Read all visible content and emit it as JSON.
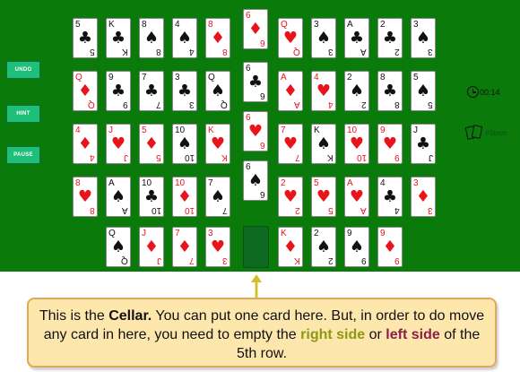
{
  "buttons": {
    "undo": "UNDO",
    "hint": "HINT",
    "pause": "PAUSE"
  },
  "status": {
    "timer": "00:14",
    "steps": "#Steps"
  },
  "cards": [
    {
      "r": "5",
      "s": "♣"
    },
    {
      "r": "K",
      "s": "♣"
    },
    {
      "r": "8",
      "s": "♠"
    },
    {
      "r": "4",
      "s": "♠"
    },
    {
      "r": "8",
      "s": "♦"
    },
    {
      "r": "6",
      "s": "♦"
    },
    {
      "r": "Q",
      "s": "♥"
    },
    {
      "r": "3",
      "s": "♠"
    },
    {
      "r": "A",
      "s": "♣"
    },
    {
      "r": "2",
      "s": "♣"
    },
    {
      "r": "3",
      "s": "♠"
    },
    {
      "r": "Q",
      "s": "♦"
    },
    {
      "r": "9",
      "s": "♣"
    },
    {
      "r": "7",
      "s": "♣"
    },
    {
      "r": "3",
      "s": "♣"
    },
    {
      "r": "Q",
      "s": "♠"
    },
    {
      "r": "6",
      "s": "♣"
    },
    {
      "r": "A",
      "s": "♦"
    },
    {
      "r": "4",
      "s": "♥"
    },
    {
      "r": "2",
      "s": "♠"
    },
    {
      "r": "8",
      "s": "♣"
    },
    {
      "r": "5",
      "s": "♠"
    },
    {
      "r": "4",
      "s": "♦"
    },
    {
      "r": "J",
      "s": "♥"
    },
    {
      "r": "5",
      "s": "♦"
    },
    {
      "r": "10",
      "s": "♠"
    },
    {
      "r": "K",
      "s": "♥"
    },
    {
      "r": "6",
      "s": "♥"
    },
    {
      "r": "7",
      "s": "♥"
    },
    {
      "r": "K",
      "s": "♠"
    },
    {
      "r": "10",
      "s": "♥"
    },
    {
      "r": "9",
      "s": "♥"
    },
    {
      "r": "J",
      "s": "♣"
    },
    {
      "r": "8",
      "s": "♥"
    },
    {
      "r": "A",
      "s": "♠"
    },
    {
      "r": "10",
      "s": "♣"
    },
    {
      "r": "10",
      "s": "♦"
    },
    {
      "r": "7",
      "s": "♠"
    },
    {
      "r": "6",
      "s": "♠"
    },
    {
      "r": "2",
      "s": "♥"
    },
    {
      "r": "5",
      "s": "♥"
    },
    {
      "r": "A",
      "s": "♥"
    },
    {
      "r": "4",
      "s": "♣"
    },
    {
      "r": "3",
      "s": "♦"
    },
    {
      "r": "Q",
      "s": "♠"
    },
    {
      "r": "J",
      "s": "♦"
    },
    {
      "r": "7",
      "s": "♦"
    },
    {
      "r": "3",
      "s": "♥"
    },
    {
      "r": "K",
      "s": "♦"
    },
    {
      "r": "2",
      "s": "♠"
    },
    {
      "r": "9",
      "s": "♠"
    },
    {
      "r": "9",
      "s": "♦"
    }
  ],
  "callout": {
    "t1": "This is the ",
    "cellar": "Cellar.",
    "t2": " You can put one card here. But, in order to do move any card in here, you  need to empty the ",
    "right": "right side",
    "t3": " or ",
    "left": "left side",
    "t4": " of the 5th row."
  },
  "colors": {
    "board": "#0a7a0a",
    "button": "#1fbf7a",
    "right_side": "#8d9a12",
    "left_side": "#8a1f4a"
  }
}
